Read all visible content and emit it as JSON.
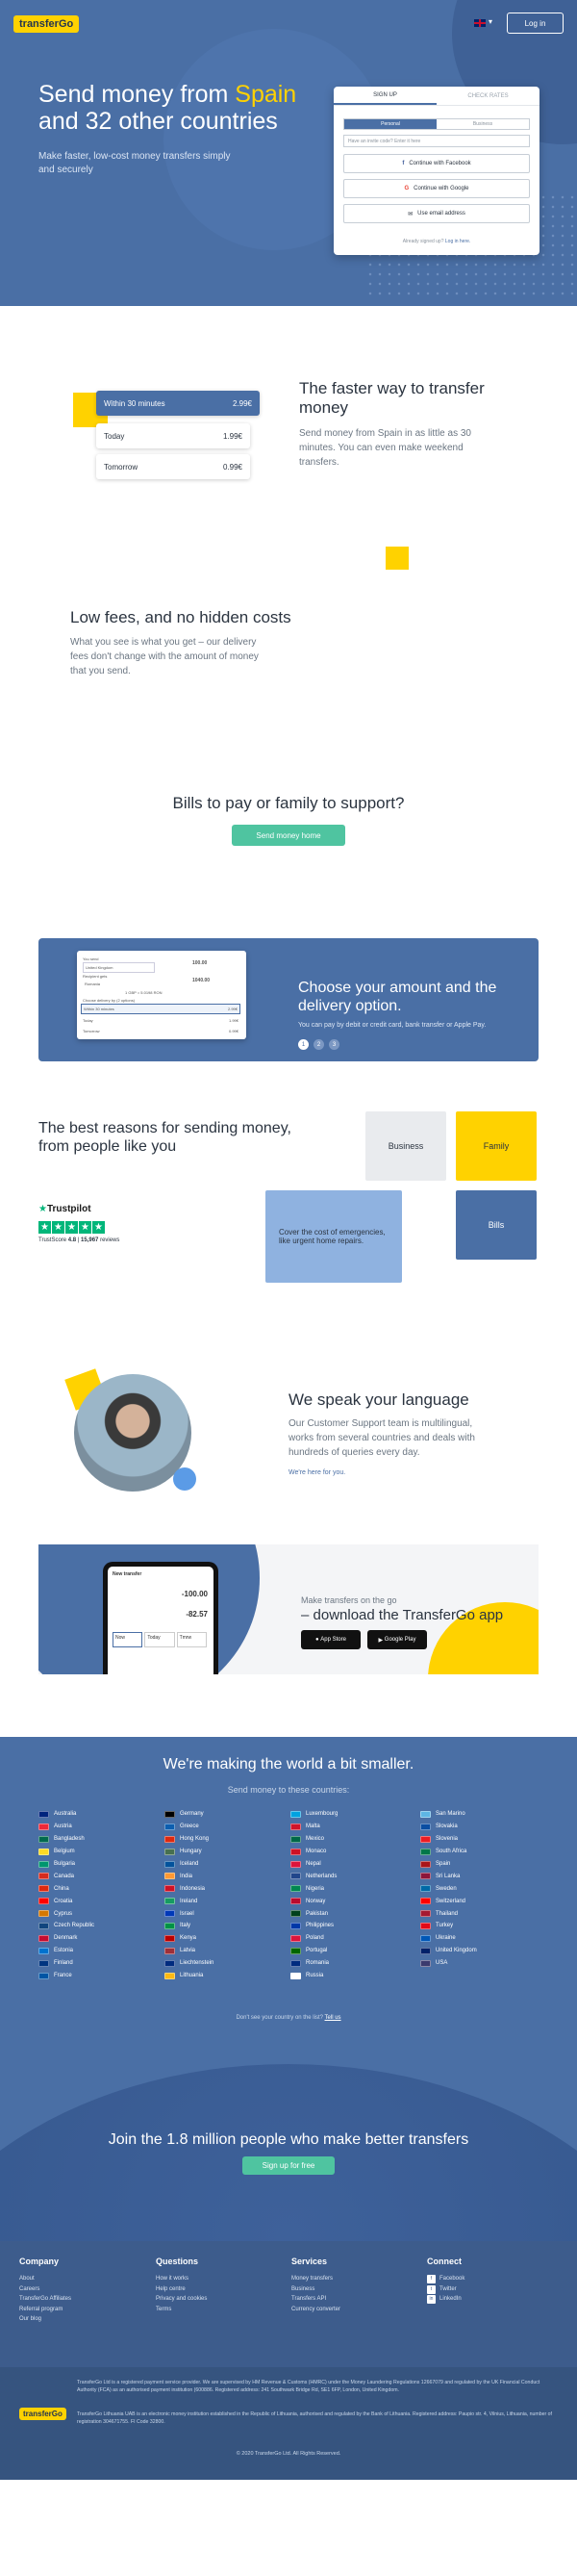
{
  "brand": {
    "logo_text": "transferGo",
    "logo_color": "#ffd200",
    "primary": "#4a6fa5",
    "accent": "#4fc4a0"
  },
  "header": {
    "lang_flag": "uk-flag-icon",
    "login_label": "Log in"
  },
  "hero": {
    "title_line1_a": "Send money from ",
    "title_highlight": "Spain",
    "title_line2": "and 32 other countries",
    "subtitle": "Make faster, low-cost money transfers simply and securely"
  },
  "signup": {
    "tab_signup": "SIGN UP",
    "tab_track": "CHECK RATES",
    "seg_personal": "Personal",
    "seg_business": "Business",
    "email_placeholder": "Have an invite code? Enter it here",
    "facebook_label": "Continue with Facebook",
    "google_label": "Continue with Google",
    "email_label": "Use email address",
    "already": "Already signed up?",
    "login_link": "Log in here."
  },
  "faster": {
    "options": [
      {
        "label": "Within 30 minutes",
        "price": "2.99€"
      },
      {
        "label": "Today",
        "price": "1.99€"
      },
      {
        "label": "Tomorrow",
        "price": "0.99€"
      }
    ],
    "title": "The faster way to transfer money",
    "text": "Send money from Spain in as little as 30 minutes. You can even make weekend transfers."
  },
  "fees": {
    "title": "Low fees, and no hidden costs",
    "text": "What you see is what you get – our delivery fees don't change with the amount of money that you send."
  },
  "bills": {
    "title": "Bills to pay or family to support?",
    "button": "Send money home"
  },
  "choose": {
    "title": "Choose your amount and the delivery option.",
    "text": "You can pay by debit or credit card, bank transfer or Apple Pay.",
    "steps": [
      "1",
      "2",
      "3"
    ],
    "mock": {
      "you_send": "You send",
      "from_country": "United Kingdom",
      "amount_a": "100.00",
      "recipient": "Recipient gets",
      "to_country": "Romania",
      "amount_b": "1040.00",
      "rate": "1 GBP = 5.0198 RON",
      "fee_line": "Choose delivery by (2 options)",
      "opt1": "Within 30 minutes",
      "opt1_price": "2.99€",
      "opt2": "Today",
      "opt2_price": "1.99€",
      "opt3": "Tomorrow",
      "opt3_price": "0.99€"
    }
  },
  "reasons": {
    "title": "The best reasons for sending money, from people like you",
    "tiles": [
      "Business",
      "Family",
      "Cover the cost of emergencies, like urgent home repairs.",
      "Bills"
    ],
    "trustpilot": {
      "name": "Trustpilot",
      "score_label": "TrustScore",
      "score": "4.8",
      "separator": "|",
      "reviews": "15,967",
      "reviews_label": "reviews"
    }
  },
  "language": {
    "title": "We speak your language",
    "text": "Our Customer Support team is multilingual, works from several countries and deals with hundreds of queries every day.",
    "link": "We're here for you."
  },
  "app": {
    "kicker": "Make transfers on the go",
    "title": "– download the TransferGo app",
    "app_store": "App Store",
    "google_play": "Google Play",
    "phone": {
      "header": "New transfer",
      "amount_a": "-100.00",
      "amount_b": "-82.57",
      "opt1": "Now",
      "opt2": "Today",
      "opt3": "Tmrw"
    }
  },
  "countries": {
    "title": "We're making the world a bit smaller.",
    "subtitle": "Send money to these countries:",
    "columns": [
      [
        "Australia",
        "Austria",
        "Bangladesh",
        "Belgium",
        "Bulgaria",
        "Canada",
        "China",
        "Croatia",
        "Cyprus",
        "Czech Republic",
        "Denmark",
        "Estonia",
        "Finland",
        "France"
      ],
      [
        "Germany",
        "Greece",
        "Hong Kong",
        "Hungary",
        "Iceland",
        "India",
        "Indonesia",
        "Ireland",
        "Israel",
        "Italy",
        "Kenya",
        "Latvia",
        "Liechtenstein",
        "Lithuania"
      ],
      [
        "Luxembourg",
        "Malta",
        "Mexico",
        "Monaco",
        "Nepal",
        "Netherlands",
        "Nigeria",
        "Norway",
        "Pakistan",
        "Philippines",
        "Poland",
        "Portugal",
        "Romania",
        "Russia"
      ],
      [
        "San Marino",
        "Slovakia",
        "Slovenia",
        "South Africa",
        "Spain",
        "Sri Lanka",
        "Sweden",
        "Switzerland",
        "Thailand",
        "Turkey",
        "Ukraine",
        "United Kingdom",
        "USA"
      ]
    ],
    "flag_colors": [
      "#00247d",
      "#ed2939",
      "#006a4e",
      "#fdda24",
      "#00966e",
      "#d52b1e",
      "#de2910",
      "#ff0000",
      "#d57800",
      "#11457e",
      "#c60c30",
      "#0072ce",
      "#003580",
      "#0055a4",
      "#000000",
      "#0d5eaf",
      "#de2910",
      "#477050",
      "#02529c",
      "#ff9933",
      "#ce1126",
      "#169b62",
      "#0038b8",
      "#009246",
      "#bb0000",
      "#9e3039",
      "#002b7f",
      "#fdb913",
      "#00a2e1",
      "#cf142b",
      "#006847",
      "#ce1126",
      "#dc143c",
      "#21468b",
      "#008751",
      "#ba0c2f",
      "#01411c",
      "#0038a8",
      "#dc143c",
      "#006600",
      "#002b7f",
      "#ffffff",
      "#5eb6e4",
      "#0b4ea2",
      "#ed1c24",
      "#007749",
      "#aa151b",
      "#8d153a",
      "#006aa7",
      "#ff0000",
      "#a51931",
      "#e30a17",
      "#0057b7",
      "#012169",
      "#3c3b6e"
    ],
    "missing": "Don't see your country on the list?",
    "missing_link": "Tell us"
  },
  "join": {
    "title": "Join the 1.8 million people who make better transfers",
    "button": "Sign up for free"
  },
  "footer": {
    "columns": [
      {
        "title": "Company",
        "items": [
          "About",
          "Careers",
          "TransferGo Affiliates",
          "Referral program",
          "Our blog"
        ]
      },
      {
        "title": "Questions",
        "items": [
          "How it works",
          "Help centre",
          "Privacy and cookies",
          "Terms"
        ]
      },
      {
        "title": "Services",
        "items": [
          "Money transfers",
          "Business",
          "Transfers API",
          "Currency converter"
        ]
      },
      {
        "title": "Connect",
        "items": [
          "Facebook",
          "Twitter",
          "LinkedIn"
        ]
      }
    ],
    "legal1": "TransferGo Ltd is a registered payment service provider. We are supervised by HM Revenue & Customs (HMRC) under the Money Laundering Regulations 12667079 and regulated by the UK Financial Conduct Authority (FCA) as an authorised payment institution (600886. Registered address: 241 Southwark Bridge Rd, SE1 6FP, London, United Kingdom.",
    "legal2": "TransferGo Lithuania UAB is an electronic money institution established in the Republic of Lithuania, authorised and regulated by the Bank of Lithuania. Registered address: Paupio str. 4, Vilnius, Lithuania, number of registration 304671755. FI Code 32800.",
    "copyright": "© 2020 TransferGo Ltd. All Rights Reserved."
  }
}
